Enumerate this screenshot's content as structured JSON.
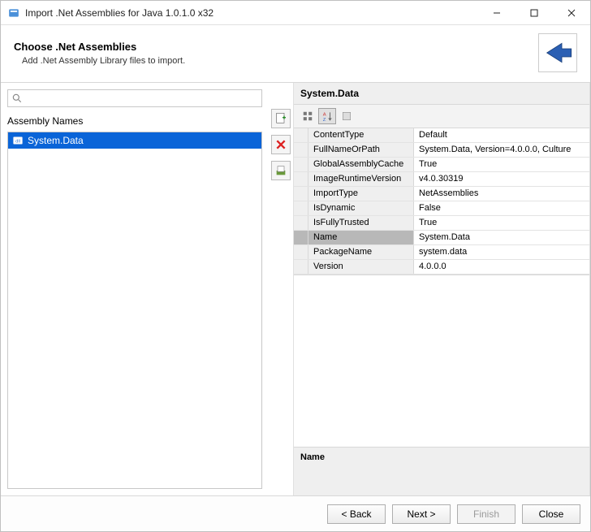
{
  "window": {
    "title": "Import .Net Assemblies for Java 1.0.1.0 x32"
  },
  "banner": {
    "heading": "Choose .Net Assemblies",
    "subheading": "Add .Net Assembly Library files to import."
  },
  "left": {
    "search_placeholder": "",
    "list_label": "Assembly Names",
    "items": [
      {
        "label": "System.Data",
        "selected": true
      }
    ]
  },
  "right": {
    "title": "System.Data",
    "properties": [
      {
        "name": "ContentType",
        "value": "Default"
      },
      {
        "name": "FullNameOrPath",
        "value": "System.Data, Version=4.0.0.0, Culture"
      },
      {
        "name": "GlobalAssemblyCache",
        "value": "True"
      },
      {
        "name": "ImageRuntimeVersion",
        "value": "v4.0.30319"
      },
      {
        "name": "ImportType",
        "value": "NetAssemblies"
      },
      {
        "name": "IsDynamic",
        "value": "False"
      },
      {
        "name": "IsFullyTrusted",
        "value": "True"
      },
      {
        "name": "Name",
        "value": "System.Data",
        "highlight": true
      },
      {
        "name": "PackageName",
        "value": "system.data"
      },
      {
        "name": "Version",
        "value": "4.0.0.0"
      }
    ],
    "description_label": "Name"
  },
  "footer": {
    "back": "< Back",
    "next": "Next >",
    "finish": "Finish",
    "close": "Close"
  }
}
